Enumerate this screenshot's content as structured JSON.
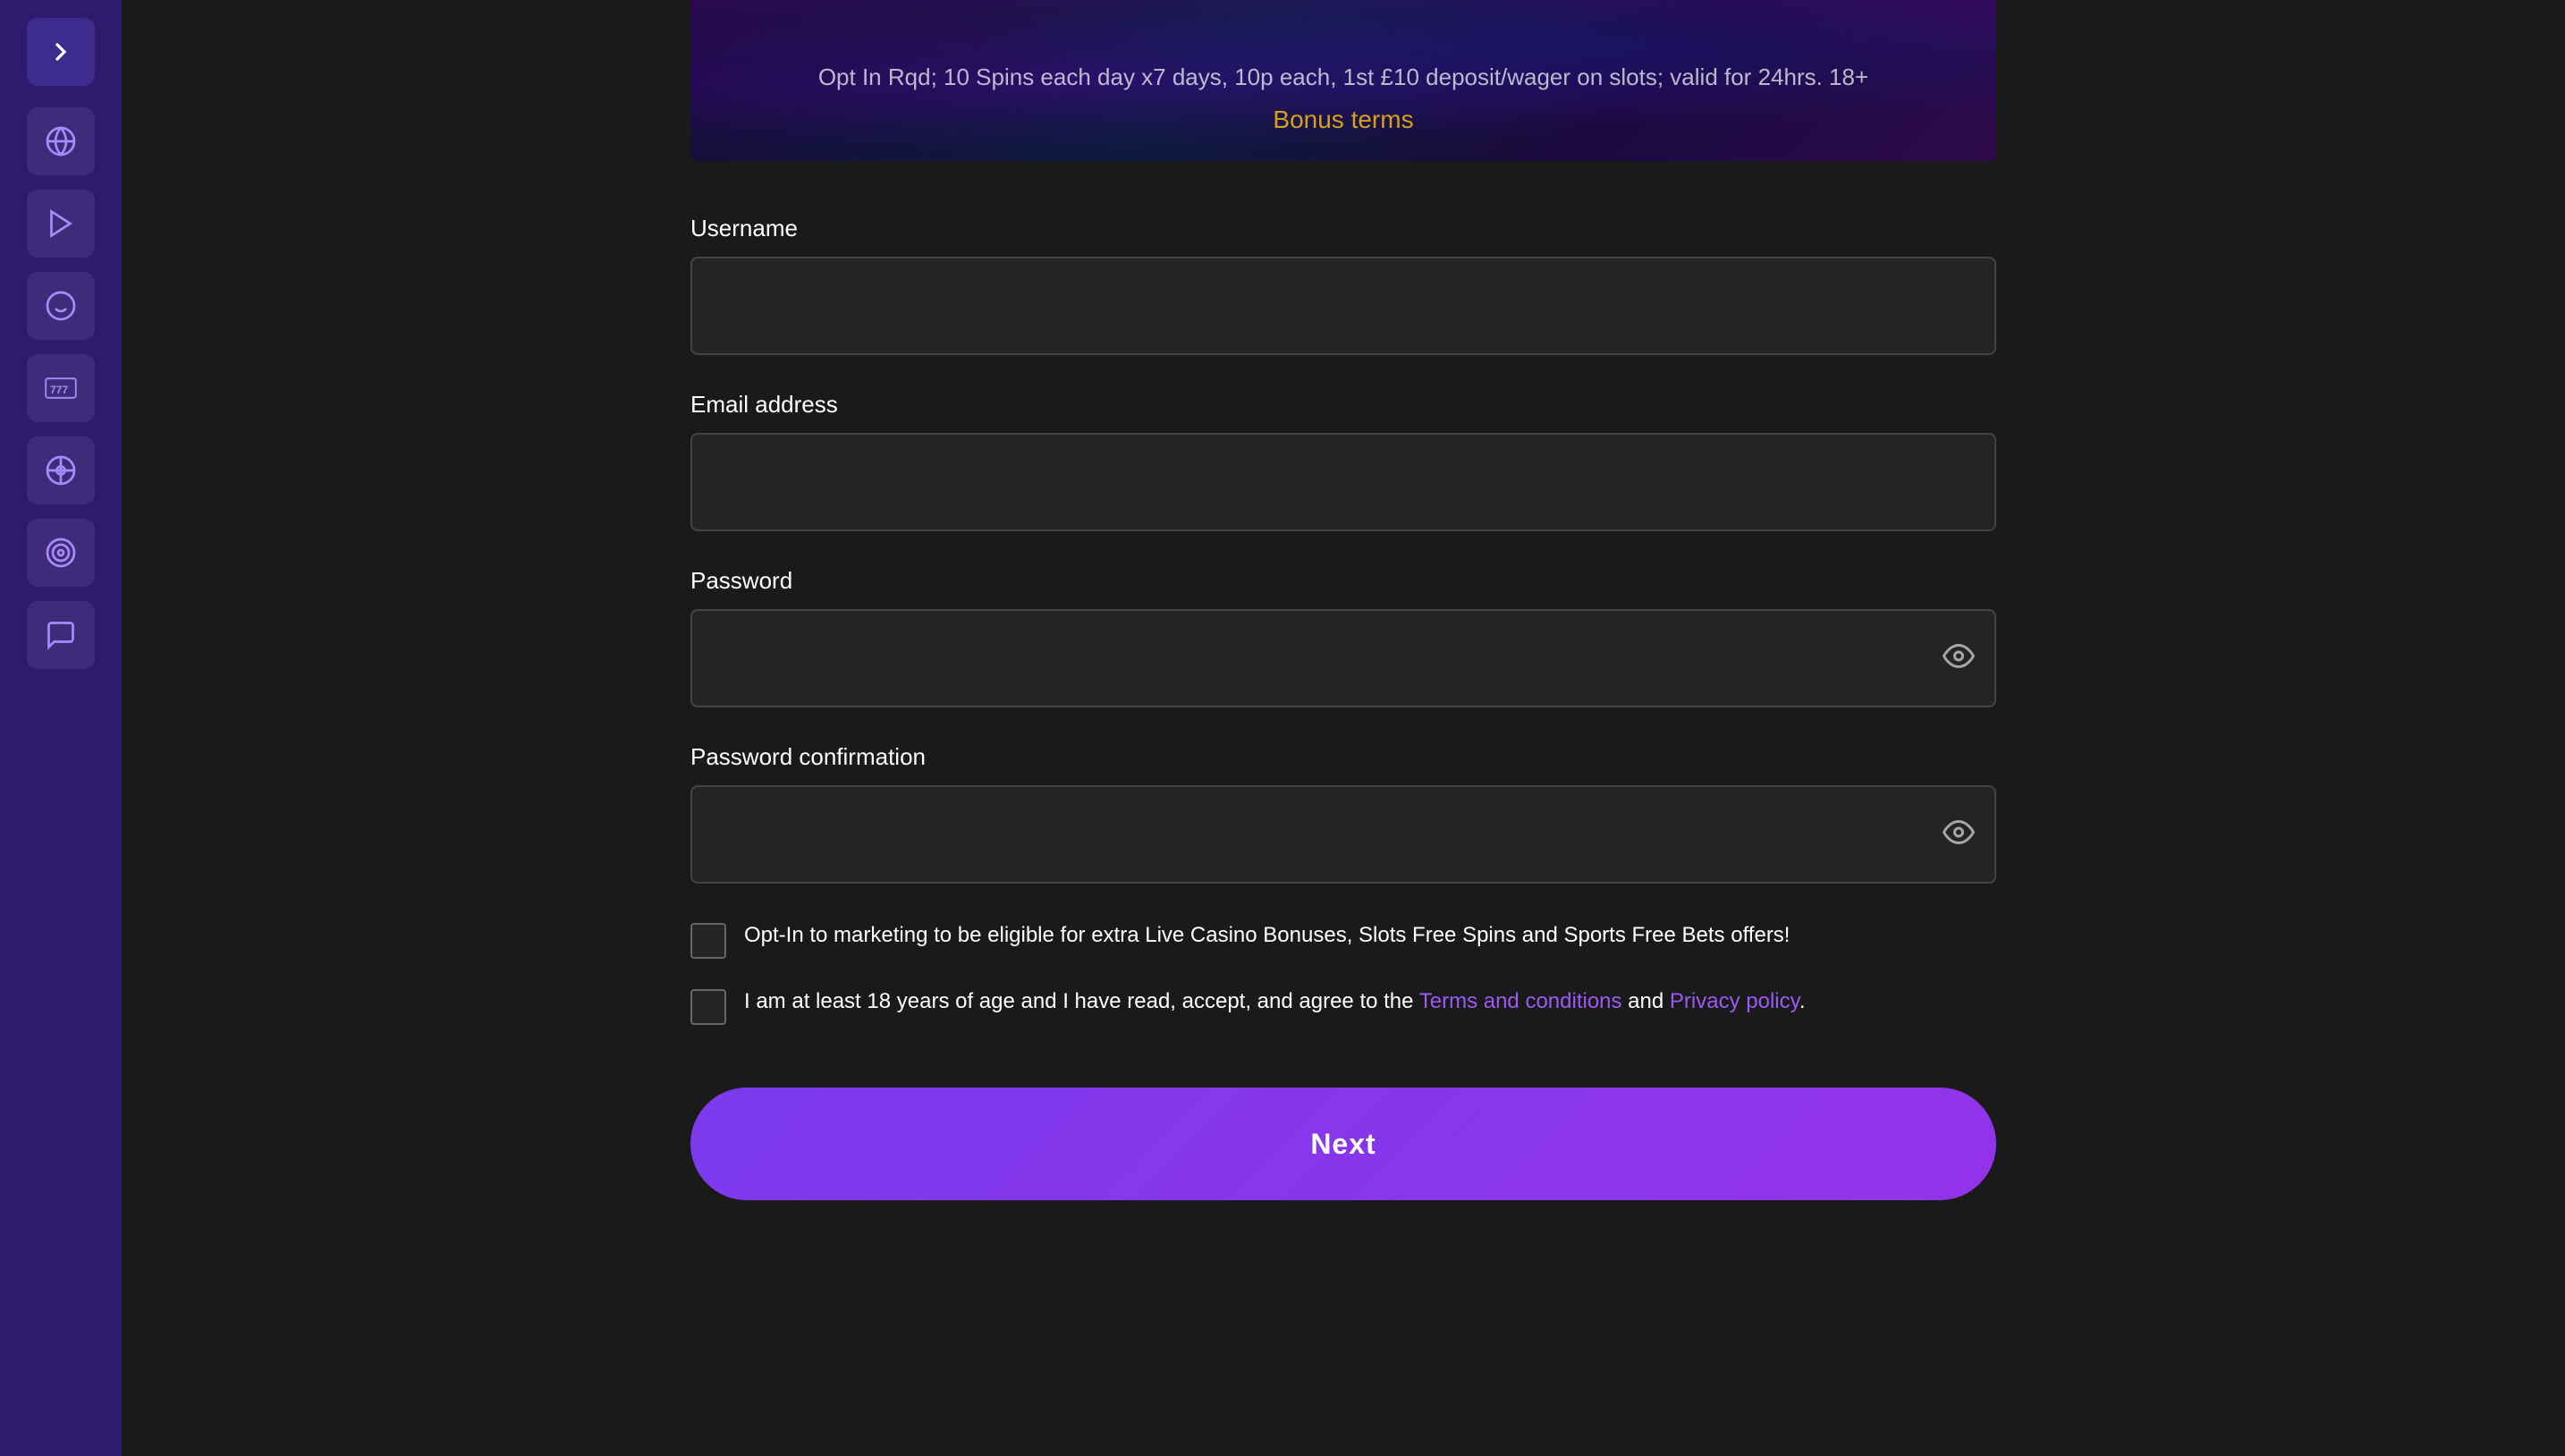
{
  "sidebar": {
    "toggle_icon": "chevron-right",
    "items": [
      {
        "id": "globe",
        "icon": "globe-icon"
      },
      {
        "id": "play",
        "icon": "play-icon"
      },
      {
        "id": "bonus",
        "icon": "bonus-icon"
      },
      {
        "id": "777",
        "icon": "777-icon"
      },
      {
        "id": "casino",
        "icon": "casino-icon"
      },
      {
        "id": "target",
        "icon": "target-icon"
      },
      {
        "id": "chat",
        "icon": "chat-icon"
      }
    ]
  },
  "banner": {
    "subtitle": "Opt In Rqd; 10 Spins each day x7 days, 10p each, 1st £10 deposit/wager on slots; valid for 24hrs. 18+",
    "link_text": "Bonus terms"
  },
  "form": {
    "username_label": "Username",
    "username_placeholder": "",
    "email_label": "Email address",
    "email_placeholder": "",
    "password_label": "Password",
    "password_placeholder": "",
    "password_confirm_label": "Password confirmation",
    "password_confirm_placeholder": "",
    "marketing_checkbox_label": "Opt-In to marketing to be eligible for extra Live Casino Bonuses, Slots Free Spins and Sports Free Bets offers!",
    "age_checkbox_text": "I am at least 18 years of age and I have read, accept, and agree to the ",
    "terms_link": "Terms and conditions",
    "and_text": " and ",
    "privacy_link": "Privacy policy",
    "period": ".",
    "next_button": "Next"
  }
}
